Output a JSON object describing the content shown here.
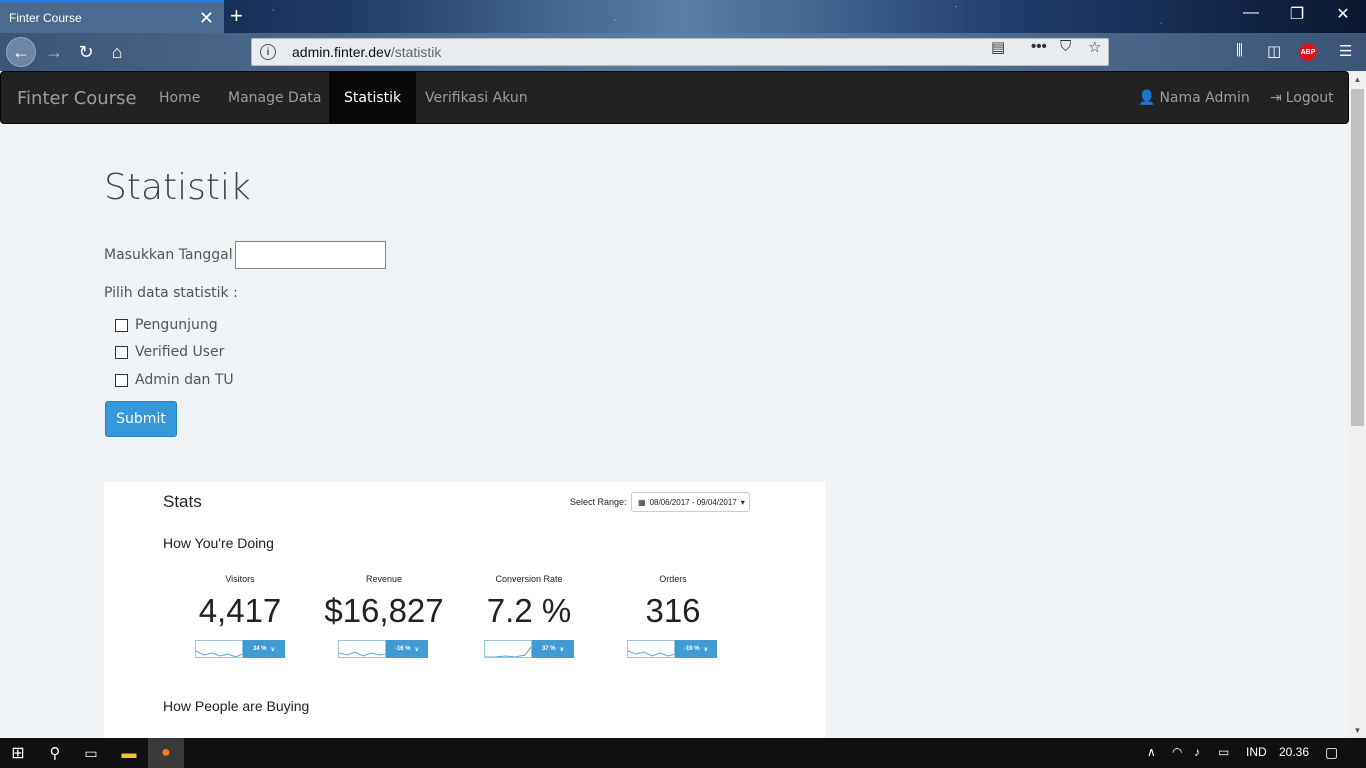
{
  "browser": {
    "tab_title": "Finter Course",
    "tab_close": "✕",
    "new_tab": "+",
    "url_domain": "admin.finter.dev",
    "url_path": "/statistik",
    "url_prefix": ""
  },
  "site_nav": {
    "brand": "Finter Course",
    "links": [
      "Home",
      "Manage Data",
      "Statistik",
      "Verifikasi Akun"
    ],
    "active": "Statistik",
    "user": "Nama Admin",
    "logout": "Logout"
  },
  "main": {
    "title": "Statistik",
    "date_label": "Masukkan Tanggal :",
    "date_value": "",
    "choose_label": "Pilih data statistik :",
    "checkboxes": [
      "Pengunjung",
      "Verified User",
      "Admin dan TU"
    ],
    "submit": "Submit"
  },
  "stats_panel": {
    "heading": "Stats",
    "range_label": "Select Range:",
    "range_value": "08/06/2017 - 09/04/2017",
    "section1": "How You're Doing",
    "section2": "How People are Buying",
    "metrics": [
      {
        "label": "Visitors",
        "value": "4,417",
        "change": "34 %"
      },
      {
        "label": "Revenue",
        "value": "$16,827",
        "change": "-16 %"
      },
      {
        "label": "Conversion Rate",
        "value": "7.2 %",
        "change": "37 %"
      },
      {
        "label": "Orders",
        "value": "316",
        "change": "-19 %"
      }
    ]
  },
  "taskbar": {
    "lang": "IND",
    "time": "20.36"
  }
}
